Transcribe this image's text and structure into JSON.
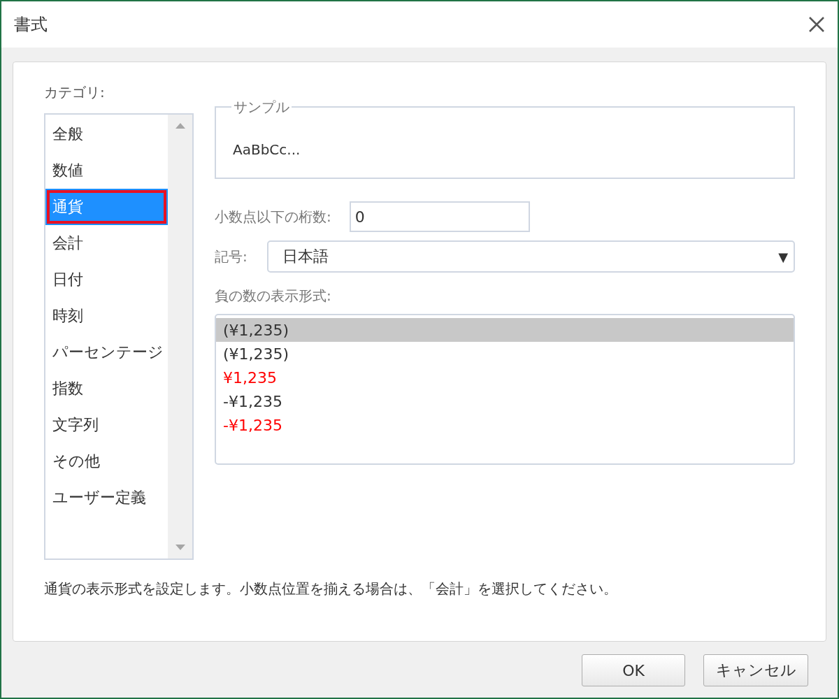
{
  "window": {
    "title": "書式"
  },
  "category": {
    "label": "カテゴリ:",
    "items": [
      {
        "label": "全般",
        "selected": false,
        "outlined": false
      },
      {
        "label": "数値",
        "selected": false,
        "outlined": false
      },
      {
        "label": "通貨",
        "selected": true,
        "outlined": true
      },
      {
        "label": "会計",
        "selected": false,
        "outlined": false
      },
      {
        "label": "日付",
        "selected": false,
        "outlined": false
      },
      {
        "label": "時刻",
        "selected": false,
        "outlined": false
      },
      {
        "label": "パーセンテージ",
        "selected": false,
        "outlined": false
      },
      {
        "label": "指数",
        "selected": false,
        "outlined": false
      },
      {
        "label": "文字列",
        "selected": false,
        "outlined": false
      },
      {
        "label": "その他",
        "selected": false,
        "outlined": false
      },
      {
        "label": "ユーザー定義",
        "selected": false,
        "outlined": false
      }
    ]
  },
  "sample": {
    "legend": "サンプル",
    "text": "AaBbCc..."
  },
  "decimal_places": {
    "label": "小数点以下の桁数:",
    "value": "0"
  },
  "symbol": {
    "label": "記号:",
    "value": "日本語",
    "arrow": "▼"
  },
  "negative_numbers": {
    "label": "負の数の表示形式:",
    "items": [
      {
        "label": "(¥1,235)",
        "selected": true,
        "color": "#333333"
      },
      {
        "label": "(¥1,235)",
        "selected": false,
        "color": "#333333"
      },
      {
        "label": "¥1,235",
        "selected": false,
        "color": "#ff0000"
      },
      {
        "label": "-¥1,235",
        "selected": false,
        "color": "#333333"
      },
      {
        "label": "-¥1,235",
        "selected": false,
        "color": "#ff0000"
      }
    ]
  },
  "description": "通貨の表示形式を設定します。小数点位置を揃える場合は、「会計」を選択してください。",
  "buttons": [
    {
      "label": "OK"
    },
    {
      "label": "キャンセル"
    }
  ]
}
